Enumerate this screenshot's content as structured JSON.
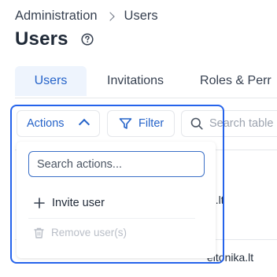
{
  "breadcrumb": {
    "parent": "Administration",
    "current": "Users"
  },
  "page": {
    "title": "Users",
    "help_icon": "question-circle-icon"
  },
  "tabs": [
    {
      "label": "Users",
      "active": true
    },
    {
      "label": "Invitations",
      "active": false
    },
    {
      "label": "Roles & Perr",
      "active": false
    }
  ],
  "toolbar": {
    "actions_label": "Actions",
    "actions_icon": "chevron-up-icon",
    "filter_label": "Filter",
    "filter_icon": "funnel-icon",
    "search_icon": "search-icon",
    "search_placeholder": "Search table"
  },
  "actions_menu": {
    "search_placeholder": "Search actions...",
    "items": [
      {
        "label": "Invite user",
        "icon": "plus-icon",
        "disabled": false
      },
      {
        "label": "Remove user(s)",
        "icon": "trash-icon",
        "disabled": true
      }
    ]
  },
  "table": {
    "row_fragments": [
      "a.lt",
      "eltonika.lt"
    ]
  },
  "colors": {
    "accent": "#2563c9",
    "focus_ring": "#2563eb",
    "active_tab_bg": "#eef4fd",
    "disabled_text": "#b9bec7"
  }
}
